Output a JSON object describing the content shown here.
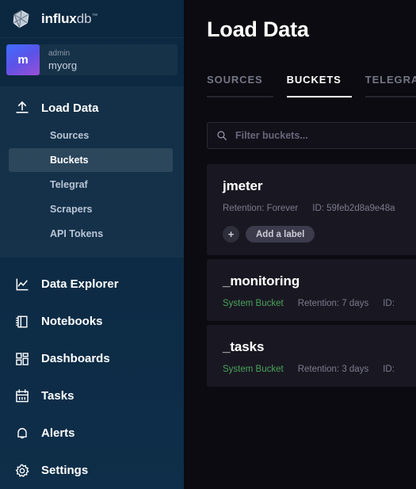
{
  "sidebar": {
    "brand": {
      "name_bold": "influx",
      "name_light": "db",
      "trademark": "™",
      "logo_icon": "influxdb-polyhedron-logo"
    },
    "org": {
      "avatar_initial": "m",
      "user": "admin",
      "org_name": "myorg"
    },
    "load_data": {
      "label": "Load Data",
      "icon": "upload-icon",
      "sub_items": [
        {
          "label": "Sources",
          "active": false
        },
        {
          "label": "Buckets",
          "active": true
        },
        {
          "label": "Telegraf",
          "active": false
        },
        {
          "label": "Scrapers",
          "active": false
        },
        {
          "label": "API Tokens",
          "active": false
        }
      ]
    },
    "nav_items": [
      {
        "label": "Data Explorer",
        "icon": "line-graph-icon"
      },
      {
        "label": "Notebooks",
        "icon": "notebook-icon"
      },
      {
        "label": "Dashboards",
        "icon": "dashboard-grid-icon"
      },
      {
        "label": "Tasks",
        "icon": "calendar-icon"
      },
      {
        "label": "Alerts",
        "icon": "bell-icon"
      },
      {
        "label": "Settings",
        "icon": "gear-icon"
      }
    ]
  },
  "main": {
    "page_title": "Load Data",
    "tabs": [
      {
        "label": "SOURCES",
        "active": false
      },
      {
        "label": "BUCKETS",
        "active": true
      },
      {
        "label": "TELEGRAF",
        "active": false
      }
    ],
    "search": {
      "placeholder": "Filter buckets...",
      "value": "",
      "icon": "search-icon"
    },
    "buckets": [
      {
        "name": "jmeter",
        "system_bucket": "",
        "retention": "Retention: Forever",
        "id": "ID: 59feb2d8a9e48a",
        "has_label_row": true,
        "add_label": "Add a label",
        "plus": "+"
      },
      {
        "name": "_monitoring",
        "system_bucket": "System Bucket",
        "retention": "Retention: 7 days",
        "id": "ID:",
        "has_label_row": false
      },
      {
        "name": "_tasks",
        "system_bucket": "System Bucket",
        "retention": "Retention: 3 days",
        "id": "ID:",
        "has_label_row": false
      }
    ]
  },
  "colors": {
    "sidebar_bg": "#0d2a43",
    "main_bg": "#0c0b11",
    "card_bg": "#191822",
    "accent_white": "#ffffff",
    "system_bucket_green": "#4aa35a",
    "avatar_gradient_start": "#3f6eff",
    "avatar_gradient_end": "#9a4fd6"
  }
}
